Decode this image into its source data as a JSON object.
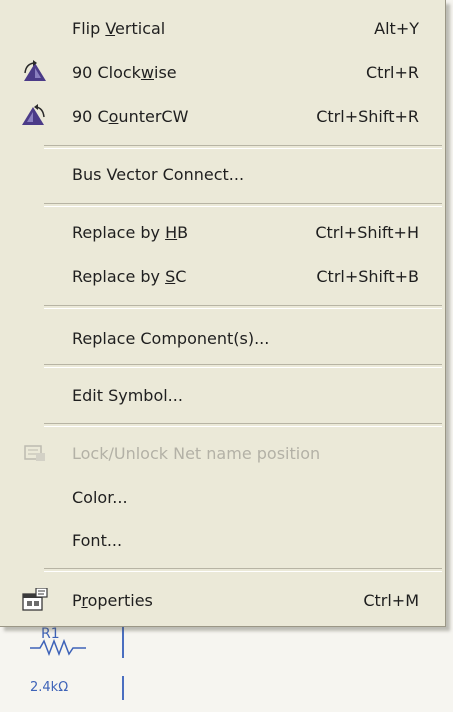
{
  "menu": {
    "items": [
      {
        "id": "flip-vertical",
        "label_pre": "Flip ",
        "label_u": "V",
        "label_post": "ertical",
        "shortcut": "Alt+Y",
        "enabled": true,
        "icon": "none"
      },
      {
        "id": "rotate-cw",
        "label_pre": "90 Clock",
        "label_u": "w",
        "label_post": "ise",
        "shortcut": "Ctrl+R",
        "enabled": true,
        "icon": "rotate-clockwise-icon"
      },
      {
        "id": "rotate-ccw",
        "label_pre": "90 C",
        "label_u": "o",
        "label_post": "unterCW",
        "shortcut": "Ctrl+Shift+R",
        "enabled": true,
        "icon": "rotate-counterclockwise-icon"
      },
      {
        "id": "bus-vector-connect",
        "label": "Bus Vector Connect...",
        "enabled": true
      },
      {
        "id": "replace-hb",
        "label_pre": "Replace by ",
        "label_u": "H",
        "label_post": "B",
        "shortcut": "Ctrl+Shift+H",
        "enabled": true
      },
      {
        "id": "replace-sc",
        "label_pre": "Replace by ",
        "label_u": "S",
        "label_post": "C",
        "shortcut": "Ctrl+Shift+B",
        "enabled": true
      },
      {
        "id": "replace-components",
        "label": "Replace Component(s)...",
        "enabled": true
      },
      {
        "id": "edit-symbol",
        "label": "Edit Symbol...",
        "enabled": true
      },
      {
        "id": "lock-unlock",
        "label": "Lock/Unlock Net name position",
        "enabled": false,
        "icon": "lock-net-name-icon"
      },
      {
        "id": "color",
        "label": "Color...",
        "enabled": true
      },
      {
        "id": "font",
        "label": "Font...",
        "enabled": true
      },
      {
        "id": "properties",
        "label_pre": "P",
        "label_u": "r",
        "label_post": "operties",
        "shortcut": "Ctrl+M",
        "enabled": true,
        "icon": "properties-icon"
      }
    ]
  },
  "schematic": {
    "resistor_name": "R1",
    "resistor_value": "2.4kΩ"
  },
  "colors": {
    "menu_bg": "#ebe9d8",
    "icon_accent": "#4b3b88",
    "wire": "#4a6ec0"
  }
}
